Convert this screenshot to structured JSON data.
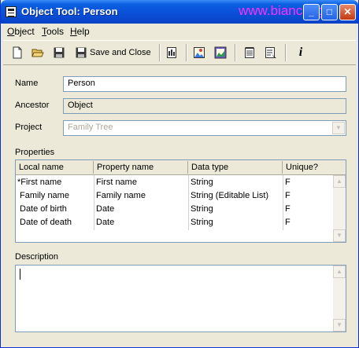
{
  "window": {
    "title": "Object Tool: Person",
    "watermark": "www.bianceng"
  },
  "menu": [
    {
      "label": "Object",
      "accel": "O"
    },
    {
      "label": "Tools",
      "accel": "T"
    },
    {
      "label": "Help",
      "accel": "H"
    }
  ],
  "toolbar": {
    "save_close_label": "Save and Close"
  },
  "icons": [
    "new-icon",
    "open-icon",
    "save-icon",
    "save-and-close-icon",
    "database-icon",
    "picture-icon",
    "picture-frame-icon",
    "note-icon",
    "checklist-icon",
    "info-icon"
  ],
  "form": {
    "name_label": "Name",
    "name_value": "Person",
    "ancestor_label": "Ancestor",
    "ancestor_value": "Object",
    "project_label": "Project",
    "project_value": "Family Tree"
  },
  "properties": {
    "label": "Properties",
    "columns": [
      "Local name",
      "Property name",
      "Data type",
      "Unique?"
    ],
    "rows": [
      [
        "*First name",
        "First name",
        "String",
        "F"
      ],
      [
        "Family name",
        "Family name",
        "String (Editable List)",
        "F"
      ],
      [
        "Date of birth",
        "Date",
        "String",
        "F"
      ],
      [
        "Date of death",
        "Date",
        "String",
        "F"
      ]
    ]
  },
  "description": {
    "label": "Description",
    "value": ""
  },
  "colors": {
    "titlebar": "#0a5fe0",
    "window_bg": "#ece9d8",
    "field_border": "#7f9db9",
    "watermark": "#ff30ff"
  }
}
